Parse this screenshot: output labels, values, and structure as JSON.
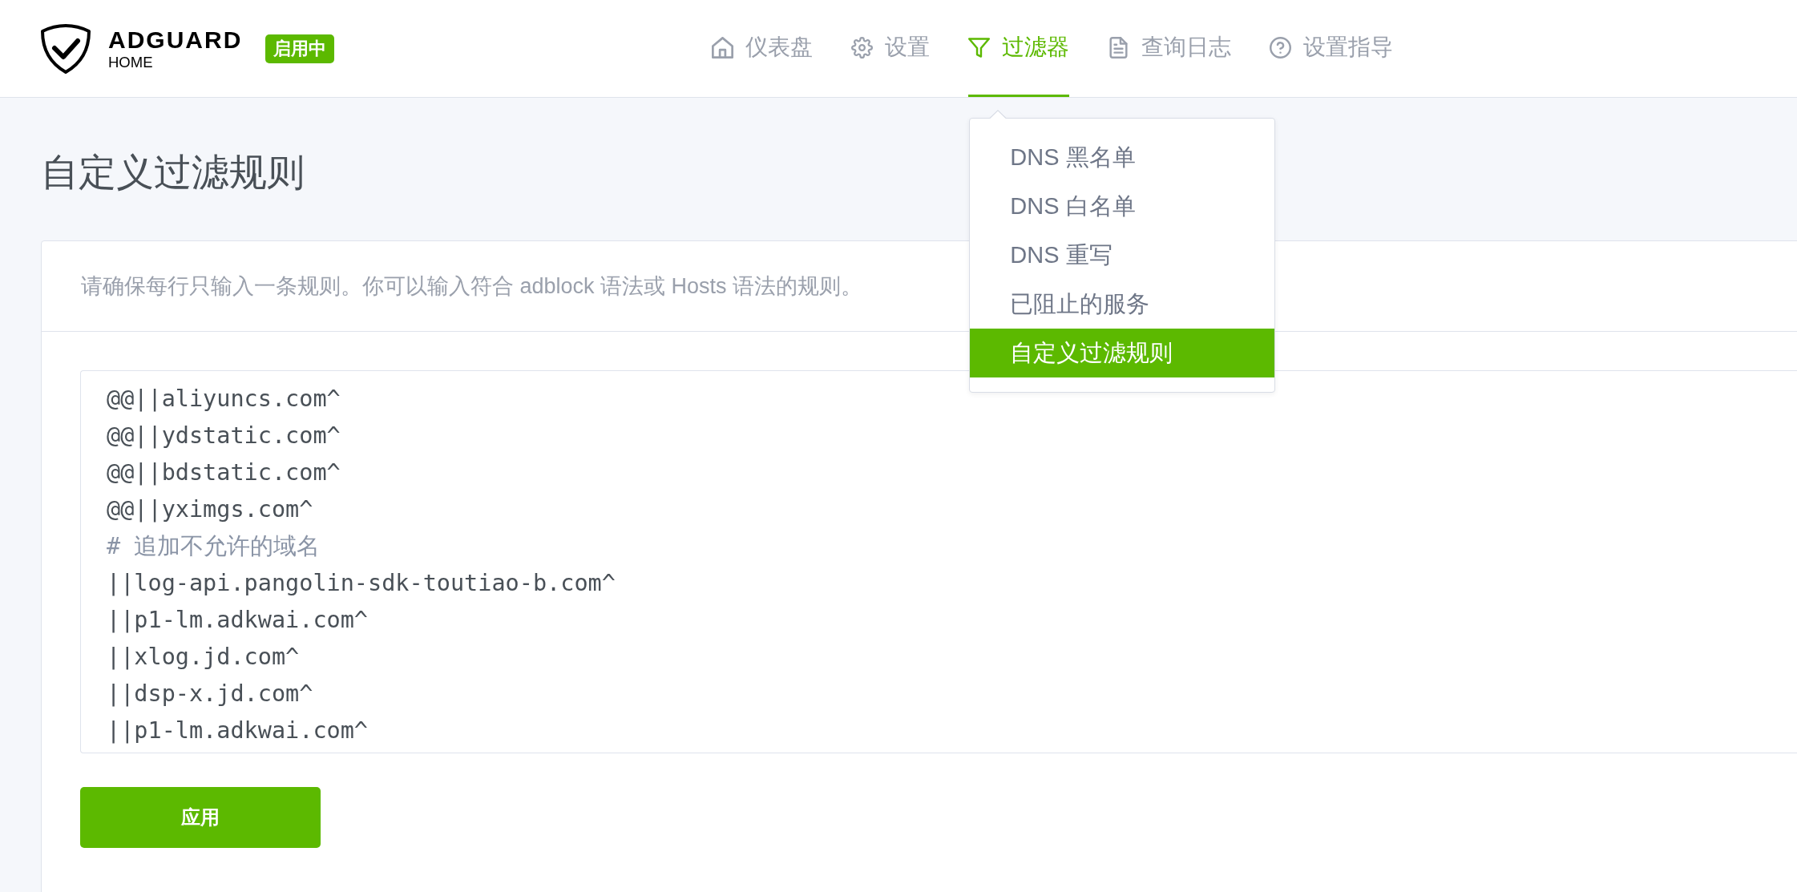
{
  "header": {
    "logo": {
      "title": "ADGUARD",
      "subtitle": "HOME"
    },
    "status_badge": "启用中",
    "nav": [
      {
        "label": "仪表盘",
        "selected": false
      },
      {
        "label": "设置",
        "selected": false
      },
      {
        "label": "过滤器",
        "selected": true,
        "menu": [
          {
            "label": "DNS 黑名单",
            "selected": false
          },
          {
            "label": "DNS 白名单",
            "selected": false
          },
          {
            "label": "DNS 重写",
            "selected": false
          },
          {
            "label": "已阻止的服务",
            "selected": false
          },
          {
            "label": "自定义过滤规则",
            "selected": true
          }
        ]
      },
      {
        "label": "查询日志",
        "selected": false
      },
      {
        "label": "设置指导",
        "selected": false
      }
    ]
  },
  "page": {
    "title": "自定义过滤规则"
  },
  "card": {
    "description": "请确保每行只输入一条规则。你可以输入符合 adblock 语法或 Hosts 语法的规则。",
    "editor": {
      "lines": [
        {
          "kind": "rule",
          "text": "@@||aliyuncs.com^"
        },
        {
          "kind": "rule",
          "text": "@@||ydstatic.com^"
        },
        {
          "kind": "rule",
          "text": "@@||bdstatic.com^"
        },
        {
          "kind": "rule",
          "text": "@@||yximgs.com^"
        },
        {
          "kind": "comment",
          "text": "# 追加不允许的域名"
        },
        {
          "kind": "rule",
          "text": "||log-api.pangolin-sdk-toutiao-b.com^"
        },
        {
          "kind": "rule",
          "text": "||p1-lm.adkwai.com^"
        },
        {
          "kind": "rule",
          "text": "||xlog.jd.com^"
        },
        {
          "kind": "rule",
          "text": "||dsp-x.jd.com^"
        },
        {
          "kind": "rule",
          "text": "||p1-lm.adkwai.com^"
        }
      ]
    },
    "apply_button": "应用"
  }
}
